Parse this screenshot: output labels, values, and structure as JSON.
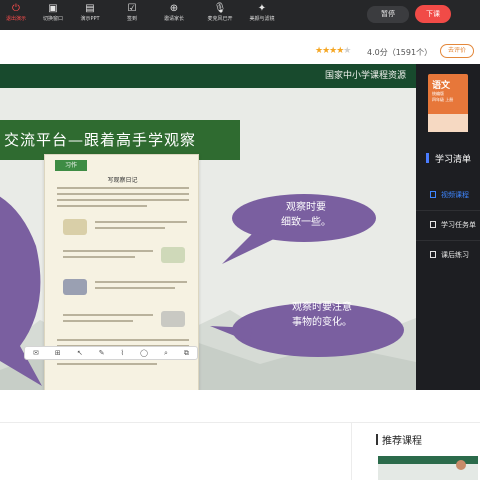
{
  "toolbar": {
    "items": [
      {
        "label": "退出演示",
        "icon": "exit-icon"
      },
      {
        "label": "切换窗口",
        "icon": "window-switch-icon"
      },
      {
        "label": "演示PPT",
        "icon": "ppt-icon"
      },
      {
        "label": "签到",
        "icon": "sign-in-icon"
      },
      {
        "label": "邀请家长",
        "icon": "invite-parent-icon"
      },
      {
        "label": "麦克风已开",
        "icon": "microphone-icon"
      },
      {
        "label": "美颜与滤镜",
        "icon": "beauty-filter-icon"
      }
    ],
    "pause_label": "暂停",
    "leave_label": "下课"
  },
  "rating": {
    "stars_filled": 4,
    "stars_total": 5,
    "score_text": "4.0分（1591个）",
    "rate_button": "去评价"
  },
  "slide": {
    "brand": "国家中小学课程资源",
    "banner_title": "交流平台—跟着高手学观察",
    "book_tag": "习作",
    "book_title": "写观察日记",
    "bubble_top": [
      "观察时要",
      "细致一些。"
    ],
    "bubble_bottom": [
      "观察时要注意",
      "事物的变化。"
    ]
  },
  "book_toolbar": [
    "✉",
    "⊞",
    "↖",
    "✎",
    "⌇",
    "◯",
    "⌕",
    "⧉"
  ],
  "panel": {
    "cover_title": "语文",
    "cover_sub": [
      "统编版",
      "四年级 上册"
    ],
    "list_title": "学习清单",
    "items": [
      {
        "label": "视频课程",
        "active": true
      },
      {
        "label": "学习任务单",
        "active": false
      },
      {
        "label": "课后练习",
        "active": false
      }
    ]
  },
  "bottom": {
    "recommend_title": "推荐课程"
  },
  "colors": {
    "toolbar_bg": "#262729",
    "leave_red": "#f14b47",
    "slide_green": "#184a2d",
    "bubble_purple": "#7a5fa0",
    "active_blue": "#3e86ff"
  }
}
